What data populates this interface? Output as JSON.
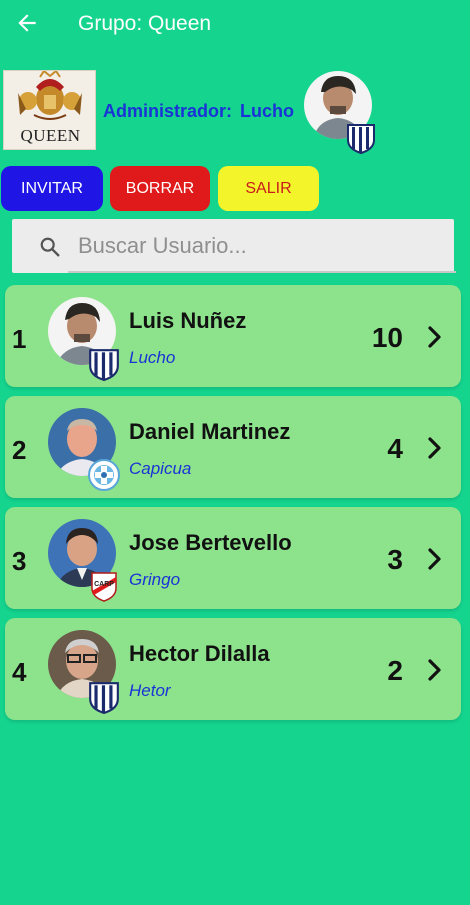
{
  "header": {
    "title": "Grupo: Queen",
    "back_icon": "arrow-left-icon"
  },
  "group": {
    "logo_text": "QUEEN",
    "admin_label": "Administrador:",
    "admin_name": "Lucho"
  },
  "actions": {
    "invite_label": "INVITAR",
    "delete_label": "BORRAR",
    "exit_label": "SALIR"
  },
  "search": {
    "placeholder": "Buscar Usuario...",
    "value": ""
  },
  "members": [
    {
      "rank": "1",
      "name": "Luis Nuñez",
      "nickname": "Lucho",
      "points": "10",
      "club_badge": "striped-blue-white-shield"
    },
    {
      "rank": "2",
      "name": "Daniel Martinez",
      "nickname": "Capicua",
      "points": "4",
      "club_badge": "light-blue-round-crest"
    },
    {
      "rank": "3",
      "name": "Jose Bertevello",
      "nickname": "Gringo",
      "points": "3",
      "club_badge": "white-red-sash-crest"
    },
    {
      "rank": "4",
      "name": "Hector Dilalla",
      "nickname": "Hetor",
      "points": "2",
      "club_badge": "striped-blue-white-shield"
    }
  ],
  "colors": {
    "background": "#14d48e",
    "row": "#8de38b",
    "invite": "#1f16e6",
    "delete": "#e01a1a",
    "exit": "#f4f42a",
    "admin_text": "#1a33d6"
  }
}
